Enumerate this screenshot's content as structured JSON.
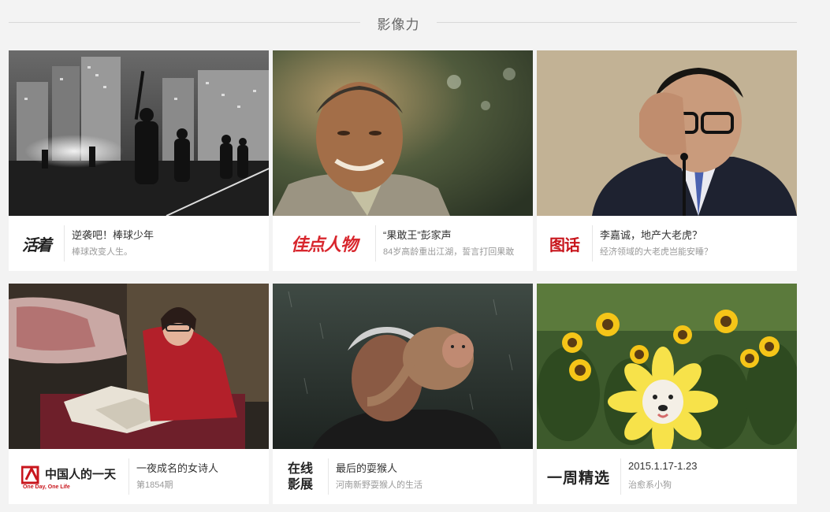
{
  "section": {
    "title": "影像力"
  },
  "cards": [
    {
      "logo_text": "活着",
      "title": "逆袭吧！棒球少年",
      "desc": "棒球改变人生。",
      "image_icon": "baseball-players-photo"
    },
    {
      "logo_text": "佳点人物",
      "title": "“果敢王”彭家声",
      "desc": "84岁高龄重出江湖，誓言打回果敢",
      "image_icon": "elderly-man-photo"
    },
    {
      "logo_text": "图话",
      "title": "李嘉诚，地产大老虎？",
      "desc": "经济领域的大老虎岂能安睡？",
      "image_icon": "businessman-photo"
    },
    {
      "logo_text": "中国人的一天",
      "logo_sub": "One Day, One Life",
      "title": "一夜成名的女诗人",
      "desc": "第1854期",
      "image_icon": "poet-reading-photo"
    },
    {
      "logo_text_line1": "在线",
      "logo_text_line2": "影展",
      "title": "最后的耍猴人",
      "desc": "河南新野耍猴人的生活",
      "image_icon": "monkey-man-photo"
    },
    {
      "logo_text": "一周精选",
      "title": "2015.1.17-1.23",
      "desc": "治愈系小狗",
      "image_icon": "sunflower-dog-photo"
    }
  ],
  "colors": {
    "background": "#f3f3f3",
    "card": "#ffffff",
    "title_text": "#333333",
    "desc_text": "#999999",
    "brand_red": "#d8262d"
  }
}
